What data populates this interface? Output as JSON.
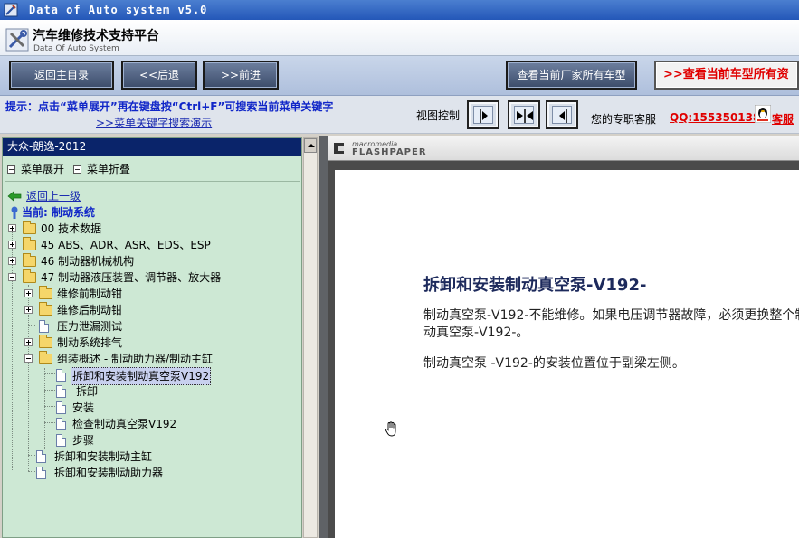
{
  "window": {
    "title": "Data of Auto system v5.0"
  },
  "header": {
    "title": "汽车维修技术支持平台",
    "subtitle": "Data Of Auto System"
  },
  "nav": {
    "back_main": "返回主目录",
    "back": "<<后退",
    "forward": ">>前进",
    "all_models": "查看当前厂家所有车型",
    "current_model_all": "查看当前车型所有资"
  },
  "hint": {
    "text": "提示：点击“菜单展开”再在键盘按“Ctrl+F”可搜索当前菜单关键字",
    "demo_link": ">>菜单关键字搜索演示",
    "view_control": "视图控制",
    "kefu_label": "您的专职客服",
    "qq": "QQ:1553501388",
    "kefu_link": "客服"
  },
  "tree": {
    "model": "大众-朗逸-2012",
    "expand": "菜单展开",
    "collapse": "菜单折叠",
    "back_up": "返回上一级",
    "current": "当前: 制动系统",
    "items": [
      "00 技术数据",
      "45 ABS、ADR、ASR、EDS、ESP",
      "46 制动器机械机构",
      "47 制动器液压装置、调节器、放大器",
      "维修前制动钳",
      "维修后制动钳",
      "压力泄漏测试",
      "制动系统排气",
      "组装概述 - 制动助力器/制动主缸",
      "拆卸和安装制动真空泵V192",
      "拆卸",
      "安装",
      "检查制动真空泵V192",
      "步骤",
      "拆卸和安装制动主缸",
      "拆卸和安装制动助力器"
    ]
  },
  "viewer": {
    "brand_small": "macromedia",
    "brand": "FLASHPAPER",
    "doc_title": "拆卸和安装制动真空泵-V192-",
    "para1": "制动真空泵-V192-不能维修。如果电压调节器故障，必须更换整个制动真空泵-V192-。",
    "para2": "制动真空泵 -V192-的安装位置位于副梁左侧。"
  },
  "colors": {
    "hint_blue": "#1026c8",
    "accent_red": "#e00000",
    "tree_bg": "#cde8d4",
    "selection_navy": "#0a246a"
  }
}
